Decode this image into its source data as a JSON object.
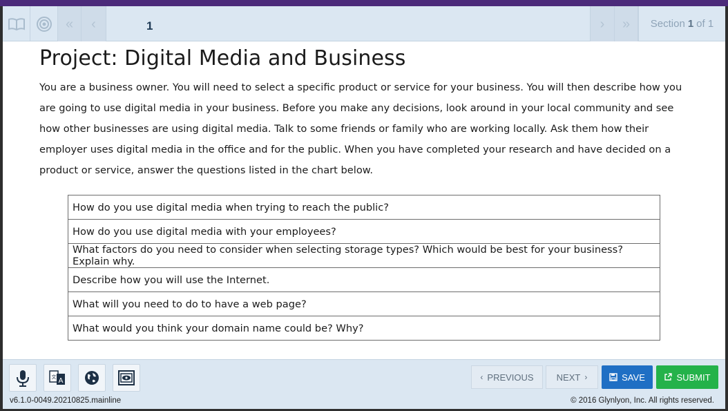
{
  "colors": {
    "frame_top": "#4b2a7a",
    "nav_bg": "#dbe7f2",
    "save_bg": "#1f6fc4",
    "submit_bg": "#24b24a"
  },
  "topnav": {
    "icons": [
      "book-icon",
      "target-icon",
      "double-chevron-left-icon",
      "chevron-left-icon",
      "chevron-right-icon",
      "double-chevron-right-icon"
    ],
    "page_number": "1",
    "section_prefix": "Section",
    "section_current": "1",
    "section_suffix": "of 1"
  },
  "content": {
    "title": "Project: Digital Media and Business",
    "intro": "You are a business owner. You will need to select a specific product or service for your business. You will then describe how you are going to use digital media in your business. Before you make any decisions, look around in your local community and see how other businesses are using digital media. Talk to some friends or family who are working locally. Ask them how their employer uses digital media in the office and for the public. When you have completed your research and have decided on a product or service, answer the questions listed in the chart below.",
    "questions": [
      "How do you use digital media when trying to reach the public?",
      "How do you use digital media with your employees?",
      "What factors do you need to consider when selecting storage types? Which would be best for your business? Explain why.",
      "Describe how you will use the Internet.",
      "What will you need to do to have a web page?",
      "What would you think your domain name could be? Why?"
    ]
  },
  "toolbar": {
    "tools": [
      "microphone-icon",
      "translate-icon",
      "globe-icon",
      "screen-mask-icon"
    ],
    "previous_label": "PREVIOUS",
    "next_label": "NEXT",
    "save_label": "SAVE",
    "submit_label": "SUBMIT"
  },
  "footer": {
    "version": "v6.1.0-0049.20210825.mainline",
    "copyright": "© 2016 Glynlyon, Inc. All rights reserved."
  }
}
